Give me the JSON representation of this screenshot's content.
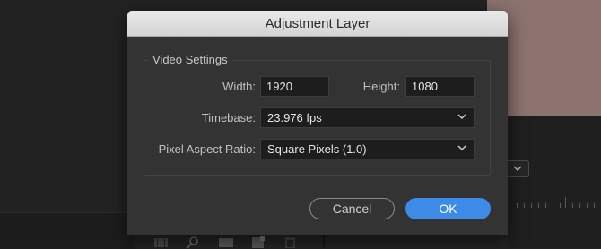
{
  "dialog": {
    "title": "Adjustment Layer",
    "section_title": "Video Settings",
    "width_label": "Width:",
    "width_value": "1920",
    "height_label": "Height:",
    "height_value": "1080",
    "timebase_label": "Timebase:",
    "timebase_value": "23.976 fps",
    "par_label": "Pixel Aspect Ratio:",
    "par_value": "Square Pixels (1.0)",
    "cancel_label": "Cancel",
    "ok_label": "OK"
  },
  "colors": {
    "accent": "#3d8be6",
    "dialog_bg": "#333333",
    "field_bg": "#1d1d1d",
    "titlebar": "#dcdcdc",
    "preview": "#8c7370"
  },
  "background_icons": [
    "list-view-icon",
    "search-icon",
    "new-item-icon",
    "new-bin-icon",
    "trash-icon",
    "chevron-down-icon"
  ]
}
